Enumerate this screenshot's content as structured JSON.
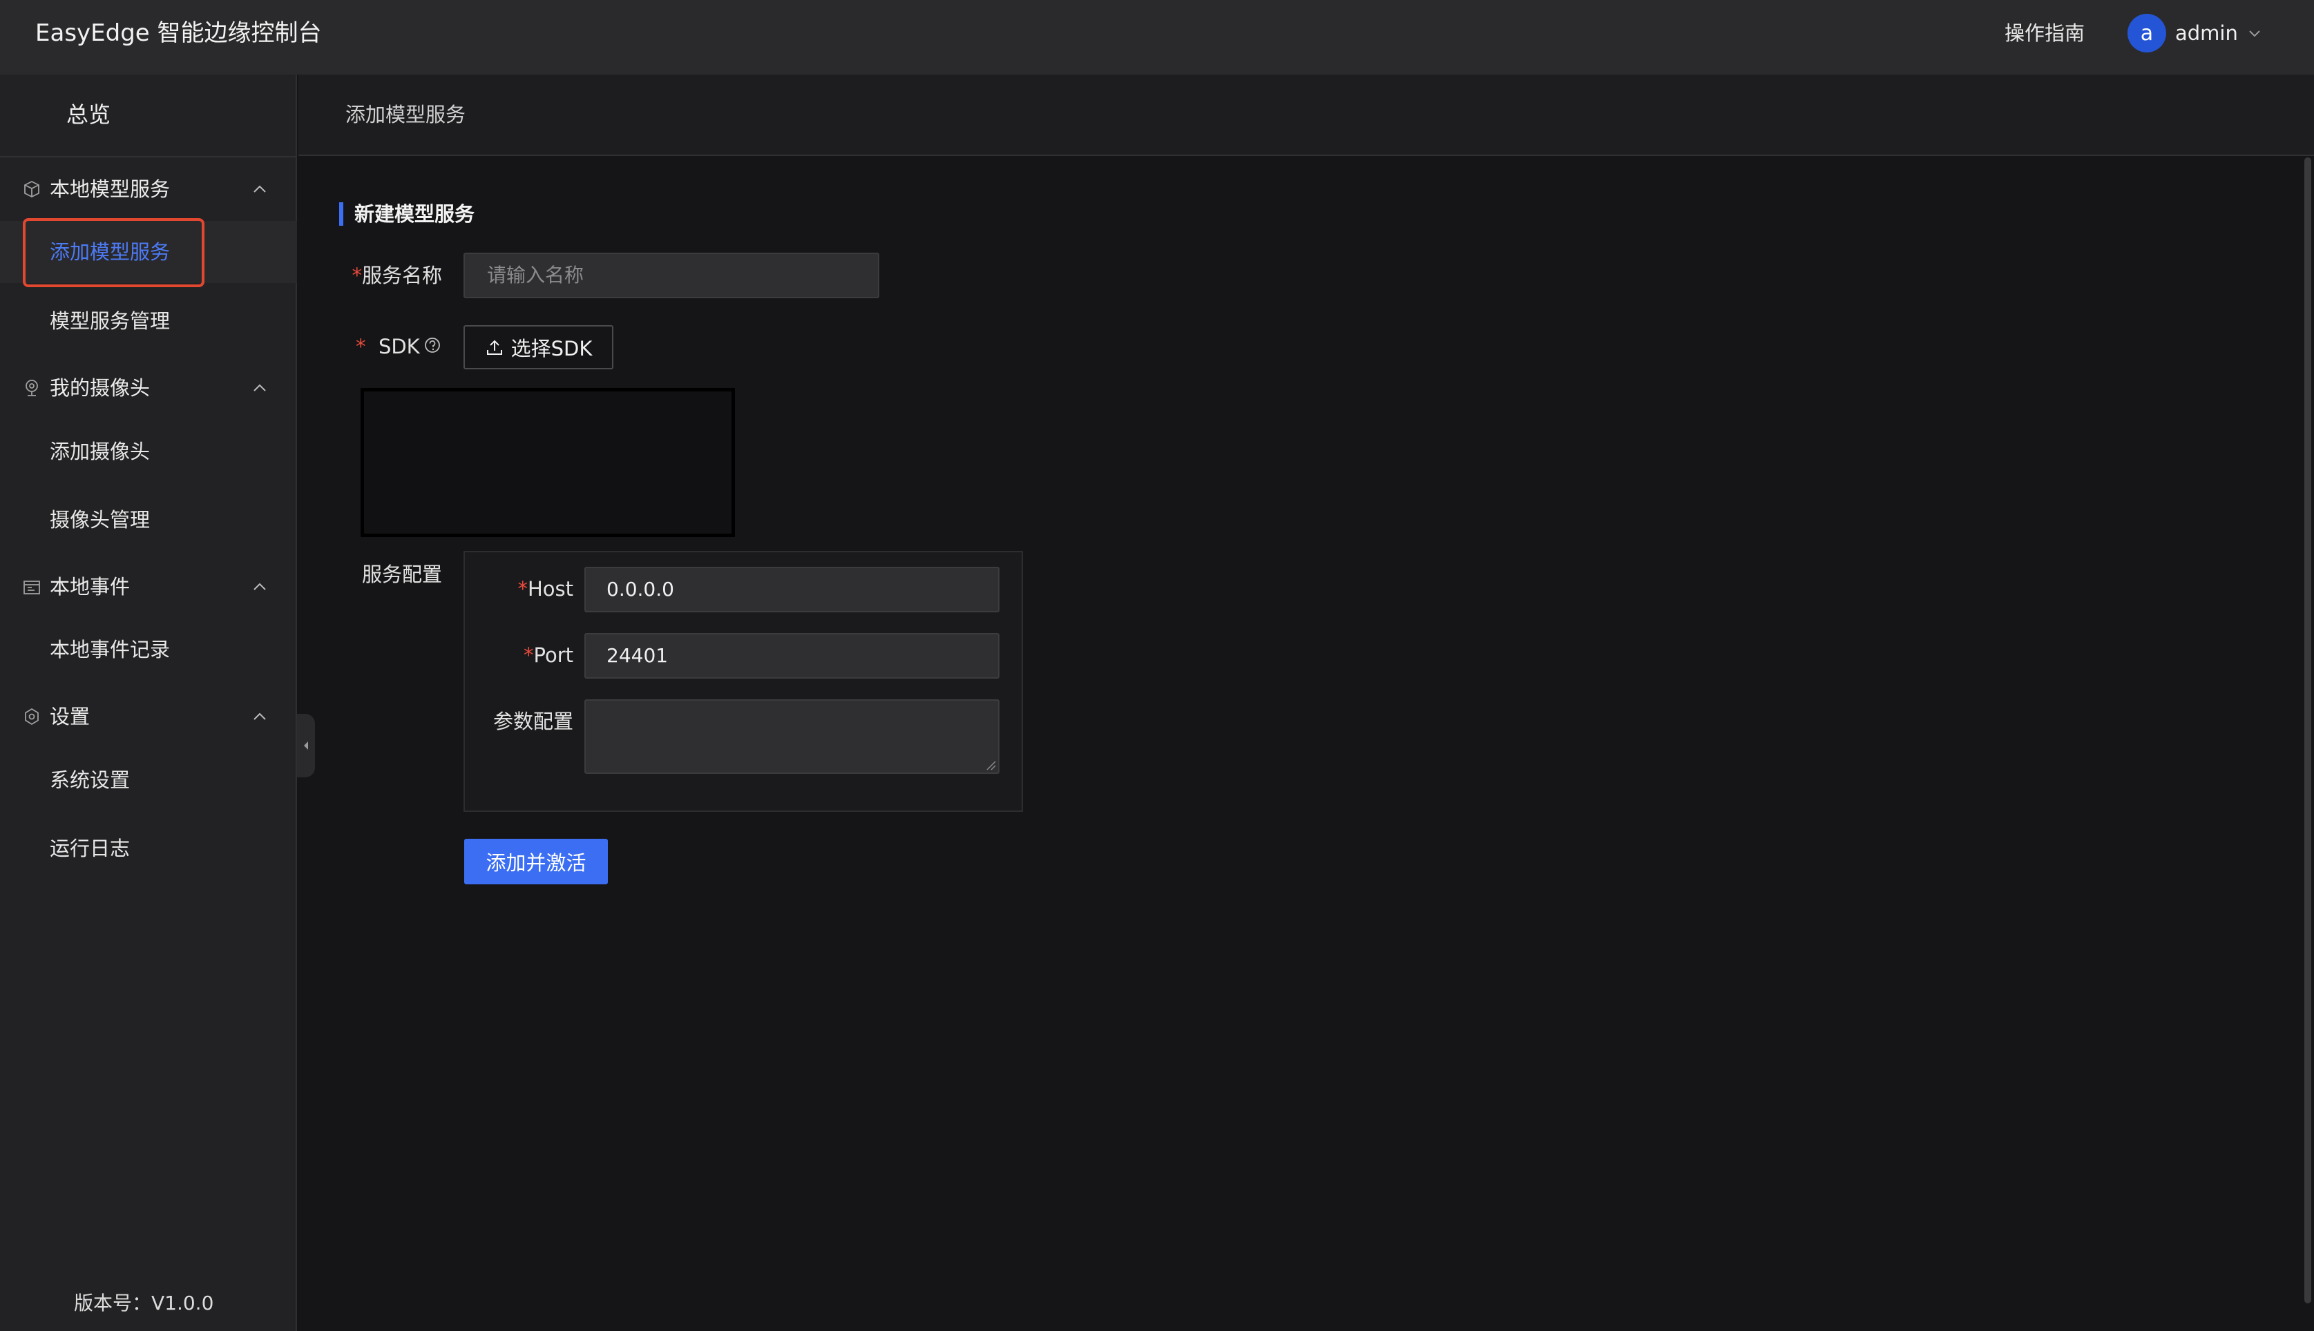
{
  "header": {
    "app_title": "EasyEdge 智能边缘控制台",
    "guide_label": "操作指南",
    "user": {
      "avatar_letter": "a",
      "name": "admin"
    }
  },
  "sidebar": {
    "overview_label": "总览",
    "groups": [
      {
        "label": "本地模型服务",
        "icon": "cube-icon",
        "items": [
          {
            "label": "添加模型服务",
            "active": true
          },
          {
            "label": "模型服务管理"
          }
        ]
      },
      {
        "label": "我的摄像头",
        "icon": "camera-icon",
        "items": [
          {
            "label": "添加摄像头"
          },
          {
            "label": "摄像头管理"
          }
        ]
      },
      {
        "label": "本地事件",
        "icon": "calendar-icon",
        "items": [
          {
            "label": "本地事件记录"
          }
        ]
      },
      {
        "label": "设置",
        "icon": "gear-icon",
        "items": [
          {
            "label": "系统设置"
          },
          {
            "label": "运行日志"
          }
        ]
      }
    ],
    "version_label": "版本号：V1.0.0"
  },
  "breadcrumb": {
    "current": "添加模型服务"
  },
  "form": {
    "section_title": "新建模型服务",
    "service_name": {
      "label": "服务名称",
      "placeholder": "请输入名称",
      "value": ""
    },
    "sdk": {
      "label": "SDK",
      "button_label": "选择SDK"
    },
    "service_config": {
      "label": "服务配置",
      "host": {
        "label": "Host",
        "value": "0.0.0.0"
      },
      "port": {
        "label": "Port",
        "value": "24401"
      },
      "params": {
        "label": "参数配置",
        "value": ""
      }
    },
    "submit_label": "添加并激活"
  },
  "colors": {
    "accent": "#3b6ef2",
    "required": "#e84a3a",
    "highlight": "#e2472f"
  }
}
